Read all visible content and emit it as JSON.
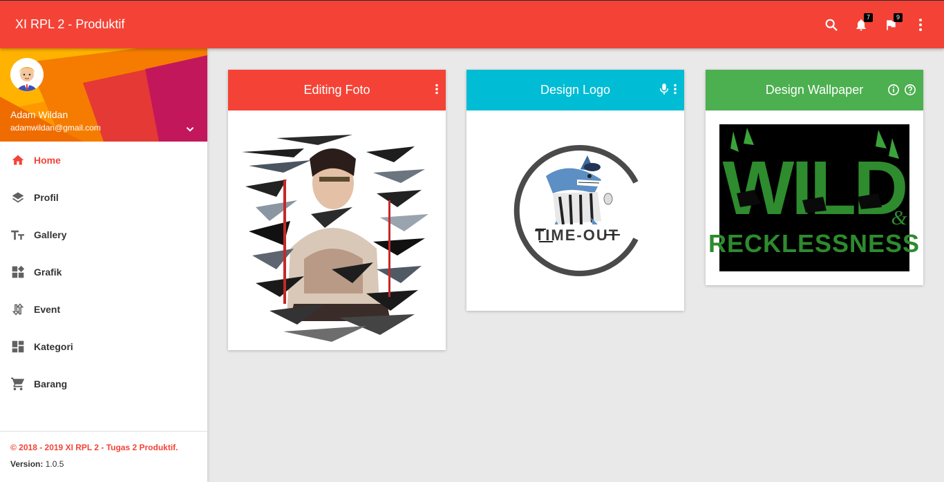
{
  "app": {
    "title": "XI RPL 2 - Produktif"
  },
  "topbar": {
    "icons": [
      {
        "name": "search-icon"
      },
      {
        "name": "notifications-icon",
        "badge": "7"
      },
      {
        "name": "flag-icon",
        "badge": "9"
      },
      {
        "name": "more-vert-icon"
      }
    ]
  },
  "user": {
    "name": "Adam Wildan",
    "email": "adamwildan@gmail.com"
  },
  "menu": [
    {
      "label": "Home",
      "icon": "home-icon",
      "active": true
    },
    {
      "label": "Profil",
      "icon": "layers-icon"
    },
    {
      "label": "Gallery",
      "icon": "text-fields-icon"
    },
    {
      "label": "Grafik",
      "icon": "widgets-icon"
    },
    {
      "label": "Event",
      "icon": "swap-vert-icon"
    },
    {
      "label": "Kategori",
      "icon": "dashboard-icon"
    },
    {
      "label": "Barang",
      "icon": "shopping-cart-icon"
    }
  ],
  "footer": {
    "copyright": "© 2018 - 2019 XI RPL 2 - Tugas 2 Produktif.",
    "version_label": "Version:",
    "version_value": "1.0.5"
  },
  "colors": {
    "primary": "#f44336",
    "card_red": "#f44336",
    "card_cyan": "#00bcd4",
    "card_green": "#4caf50",
    "background": "#e9e9e9"
  },
  "cards": [
    {
      "title": "Editing Foto",
      "color": "#f44336",
      "actions": [
        "more-vert-icon"
      ],
      "image": "glitched-portrait-photo"
    },
    {
      "title": "Design Logo",
      "color": "#00bcd4",
      "actions": [
        "mic-icon",
        "more-vert-icon"
      ],
      "image": "shark-mascot-logo"
    },
    {
      "title": "Design Wallpaper",
      "color": "#4caf50",
      "actions": [
        "info-icon",
        "help-icon"
      ],
      "image": "wild-recklessness-wallpaper"
    }
  ]
}
